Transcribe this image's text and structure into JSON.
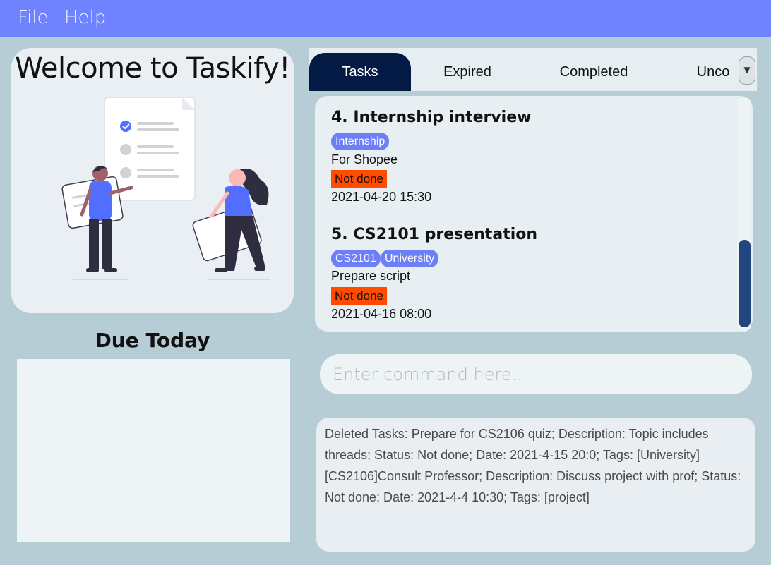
{
  "menu": {
    "file": "File",
    "help": "Help"
  },
  "welcome": {
    "title": "Welcome to Taskify!"
  },
  "due_today": {
    "title": "Due Today",
    "items": []
  },
  "tabs": [
    {
      "label": "Tasks",
      "active": true
    },
    {
      "label": "Expired",
      "active": false
    },
    {
      "label": "Completed",
      "active": false
    },
    {
      "label": "Unco",
      "active": false
    }
  ],
  "tasks": [
    {
      "index": "4.",
      "title": "Internship interview",
      "tags": [
        "Internship"
      ],
      "description": "For Shopee",
      "status": "Not done",
      "date": "2021-04-20 15:30"
    },
    {
      "index": "5.",
      "title": "CS2101 presentation",
      "tags": [
        "CS2101",
        "University"
      ],
      "description": "Prepare script",
      "status": "Not done",
      "date": "2021-04-16 08:00"
    }
  ],
  "command": {
    "placeholder": "Enter command here...",
    "value": ""
  },
  "result": {
    "text": "Deleted Tasks: Prepare for CS2106 quiz; Description: Topic includes threads; Status: Not done; Date: 2021-4-15 20:0; Tags: [University][CS2106]Consult Professor; Description: Discuss project with prof; Status: Not done; Date: 2021-4-4 10:30; Tags: [project]"
  },
  "colors": {
    "menubar": "#6e83fd",
    "background": "#b7cdd6",
    "active_tab": "#031a44",
    "tag": "#6d7ff6",
    "status_not_done": "#ff4c00",
    "scroll_thumb": "#23467f"
  },
  "icons": {
    "dropdown": "chevron-down-icon"
  }
}
